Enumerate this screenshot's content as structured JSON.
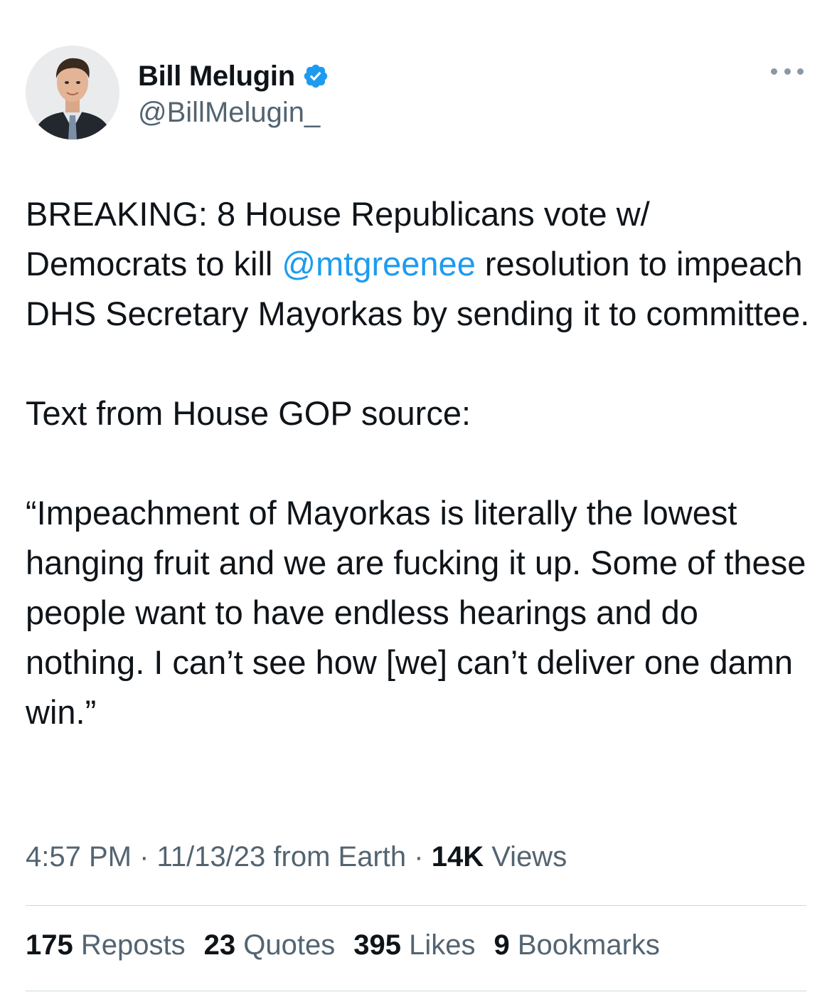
{
  "author": {
    "display_name": "Bill Melugin",
    "handle": "@BillMelugin_",
    "verified": true,
    "verified_color": "#1d9bf0"
  },
  "more_menu_icon": "more-dots-icon",
  "body": {
    "p1": {
      "before_mention": "BREAKING: 8 House Republicans vote w/ Democrats to kill ",
      "mention": "@mtgreenee",
      "after_mention": " resolution to impeach DHS Secretary Mayorkas by sending it to committee."
    },
    "p2": "Text from House GOP source:",
    "p3": "“Impeachment of Mayorkas is literally the lowest hanging fruit and we are fucking it up. Some of these people want to have endless hearings and do nothing. I can’t see how [we] can’t deliver one damn win.”"
  },
  "meta": {
    "time": "4:57 PM",
    "separator": "·",
    "date_source": "11/13/23 from Earth",
    "views_count": "14K",
    "views_label": "Views"
  },
  "stats": [
    {
      "count": "175",
      "label": "Reposts"
    },
    {
      "count": "23",
      "label": "Quotes"
    },
    {
      "count": "395",
      "label": "Likes"
    },
    {
      "count": "9",
      "label": "Bookmarks"
    }
  ],
  "colors": {
    "text_primary": "#0f1419",
    "text_secondary": "#536471",
    "link": "#1d9bf0",
    "divider": "#cfd9de"
  }
}
